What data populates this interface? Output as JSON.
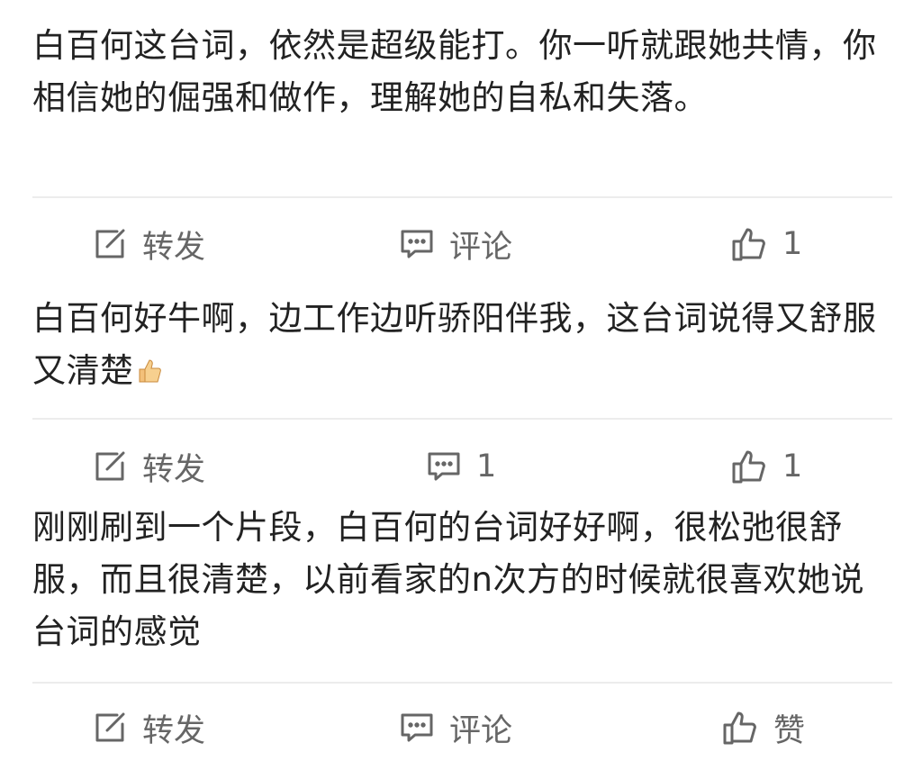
{
  "posts": [
    {
      "text": "白百何这台词，依然是超级能打。你一听就跟她共情，你相信她的倔强和做作，理解她的自私和失落。",
      "actions": {
        "repost": "转发",
        "comment": "评论",
        "like": "1"
      }
    },
    {
      "text": "白百何好牛啊，边工作边听骄阳伴我，这台词说得又舒服又清楚",
      "emoji": "thumbs-up",
      "actions": {
        "repost": "转发",
        "comment": "1",
        "like": "1"
      }
    },
    {
      "text": "刚刚刷到一个片段，白百何的台词好好啊，很松弛很舒服，而且很清楚，以前看家的n次方的时候就很喜欢她说台词的感觉",
      "actions": {
        "repost": "转发",
        "comment": "评论",
        "like": "赞"
      }
    }
  ],
  "icons": {
    "repost": "repost-icon",
    "comment": "comment-icon",
    "like": "thumbs-up-icon"
  },
  "colors": {
    "text": "#222222",
    "action": "#666666",
    "divider": "#ececec"
  }
}
